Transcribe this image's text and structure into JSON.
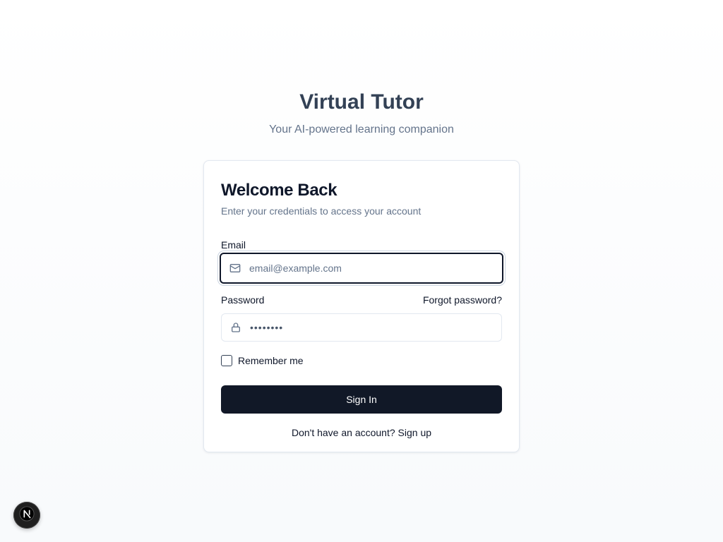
{
  "header": {
    "title": "Virtual Tutor",
    "subtitle": "Your AI-powered learning companion"
  },
  "card": {
    "title": "Welcome Back",
    "description": "Enter your credentials to access your account"
  },
  "email": {
    "label": "Email",
    "placeholder": "email@example.com",
    "value": "",
    "icon": "mail-icon"
  },
  "password": {
    "label": "Password",
    "masked_value": "••••••••",
    "icon": "lock-icon",
    "forgot_label": "Forgot password?"
  },
  "remember": {
    "label": "Remember me",
    "checked": false
  },
  "signin": {
    "label": "Sign In"
  },
  "signup": {
    "prompt": "Don't have an account?",
    "link_label": "Sign up"
  },
  "dev_badge": {
    "icon": "nextjs-logo-icon",
    "letter": "N"
  },
  "colors": {
    "title": "#334155",
    "muted": "#64748b",
    "primary_button": "#111827",
    "border": "#e2e8f0"
  }
}
